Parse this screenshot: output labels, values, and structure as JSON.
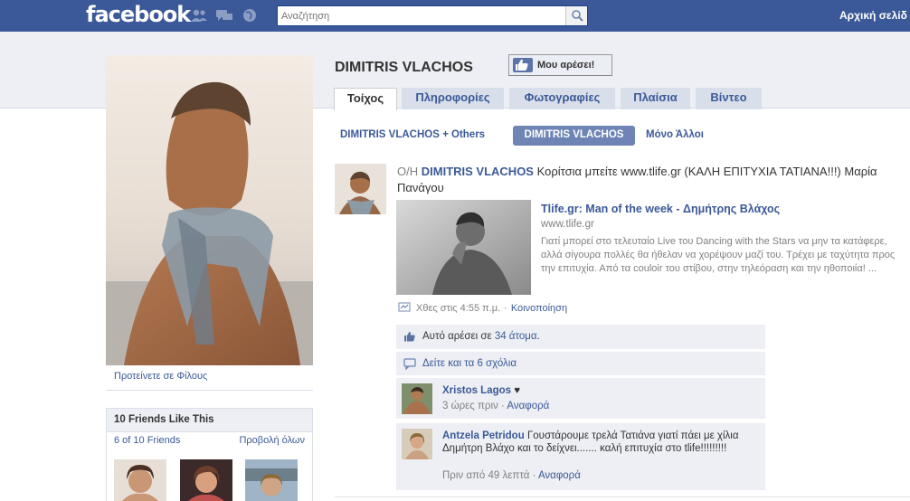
{
  "topbar": {
    "logo": "facebook",
    "search_placeholder": "Αναζήτηση",
    "home_label": "Αρχική σελίδ"
  },
  "colors": {
    "brand_blue": "#3b5998",
    "light_band": "#edeff4",
    "tab_bg": "#d8dfea",
    "filter_active": "#6d84b4"
  },
  "icons": [
    "friend-requests-icon",
    "messages-icon",
    "notifications-icon",
    "search-icon",
    "like-thumb-icon",
    "link-post-icon",
    "comment-bubble-icon"
  ],
  "profile": {
    "name": "DIMITRIS VLACHOS",
    "like_button": "Μου αρέσει!",
    "suggest_link": "Προτείνετε σε Φίλους"
  },
  "tabs": [
    {
      "label": "Τοίχος",
      "active": true
    },
    {
      "label": "Πληροφορίες",
      "active": false
    },
    {
      "label": "Φωτογραφίες",
      "active": false
    },
    {
      "label": "Πλαίσια",
      "active": false
    },
    {
      "label": "Βίντεο",
      "active": false
    }
  ],
  "filters": {
    "all": "DIMITRIS VLACHOS + Others",
    "mine": "DIMITRIS VLACHOS",
    "others": "Μόνο Άλλοι"
  },
  "friends_box": {
    "title": "10 Friends Like This",
    "count": "6 of 10 Friends",
    "view_all": "Προβολή όλων"
  },
  "story": {
    "prefix": "Ο/Η",
    "author": "DIMITRIS VLACHOS",
    "message": "Κορίτσια μπείτε www.tlife.gr (ΚΑΛΗ ΕΠΙΤΥΧΙΑ ΤΑΤΙΑΝΑ!!!) Μαρία Πανάγου",
    "attachment": {
      "title": "Tlife.gr: Man of the week - Δημήτρης Βλάχος",
      "url": "www.tlife.gr",
      "description": "Γιατί μπορεί στο τελευταίο Live του Dancing with the Stars να μην τα κατάφερε, αλλά σίγουρα πολλές θα ήθελαν να χορέψουν μαζί του. Τρέχει με ταχύτητα προς την επιτυχία. Από τα couloir του στίβου, στην τηλεόραση και την ηθοποιία! ..."
    },
    "time": "Χθες στις 4:55 π.μ.",
    "separator": "·",
    "share": "Κοινοποίηση",
    "likes_prefix": "Αυτό αρέσει σε",
    "likes_link": "34 άτομα",
    "likes_suffix": ".",
    "comments_link": "Δείτε και τα 6 σχόλια"
  },
  "comments": [
    {
      "author": "Xristos Lagos",
      "text": "♥",
      "time": "3 ώρες πριν",
      "separator": "·",
      "action": "Αναφορά"
    },
    {
      "author": "Antzela Petridou",
      "text": "Γουστάρουμε τρελά Τατιάνα γιατί πάει με χίλια Δημήτρη Βλάχο και το δείχνει....... καλή επιτυχία στο tlife!!!!!!!!!",
      "time": "Πριν από 49 λεπτά",
      "separator": "·",
      "action": "Αναφορά"
    }
  ]
}
